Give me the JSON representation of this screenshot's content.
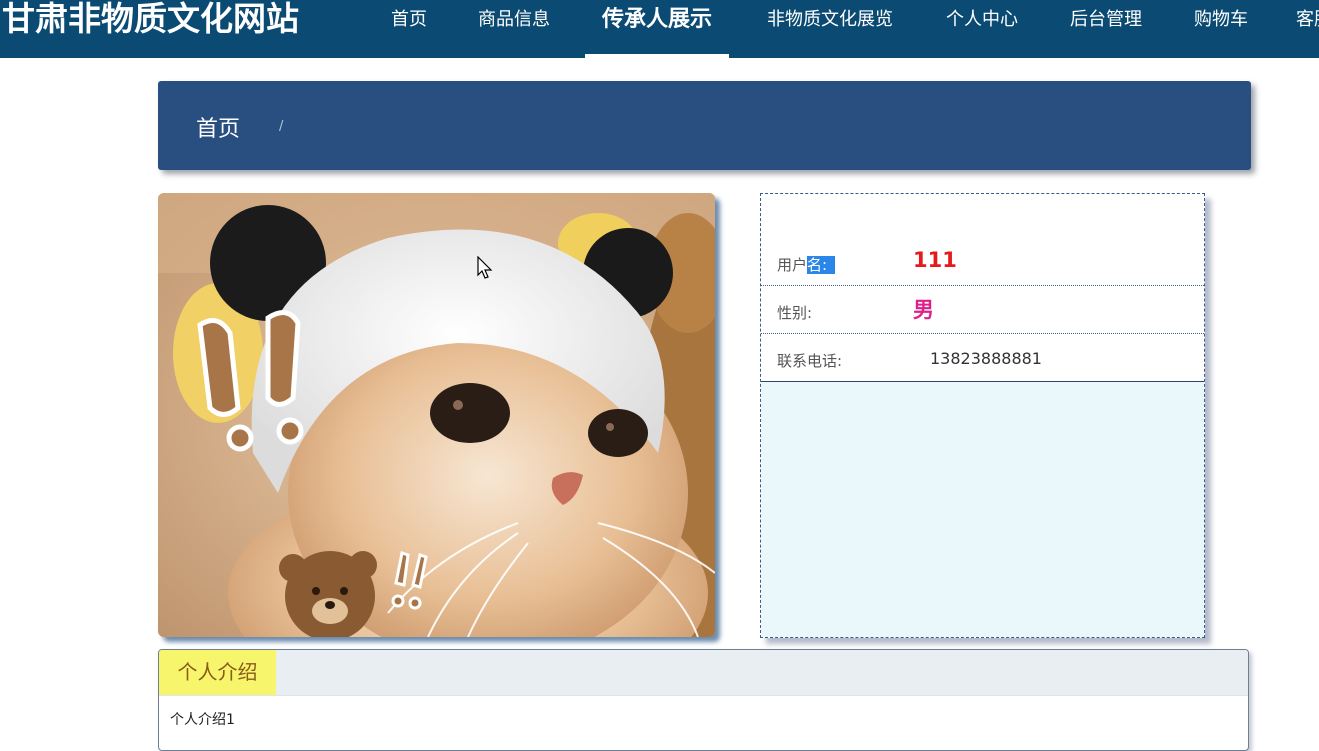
{
  "site": {
    "title": "甘肃非物质文化网站"
  },
  "nav": {
    "items": [
      {
        "label": "首页"
      },
      {
        "label": "商品信息"
      },
      {
        "label": "传承人展示",
        "active": true
      },
      {
        "label": "非物质文化展览"
      },
      {
        "label": "个人中心"
      },
      {
        "label": "后台管理"
      },
      {
        "label": "购物车"
      },
      {
        "label": "客服"
      }
    ]
  },
  "breadcrumb": {
    "home": "首页",
    "separator": "/"
  },
  "profile": {
    "username_label_part1": "用户",
    "username_label_part2": "名:",
    "username_value": "111",
    "gender_label": "性别:",
    "gender_value": "男",
    "phone_label": "联系电话:",
    "phone_value": "13823888881",
    "avatar_icon": "cat-photo"
  },
  "intro": {
    "tab_label": "个人介绍",
    "content": "个人介绍1"
  },
  "colors": {
    "nav_bg": "#0b4b73",
    "banner_bg": "#294f80",
    "name_color": "#e6191c",
    "gender_color": "#e0208a",
    "tab_bg": "#f6f56b"
  }
}
